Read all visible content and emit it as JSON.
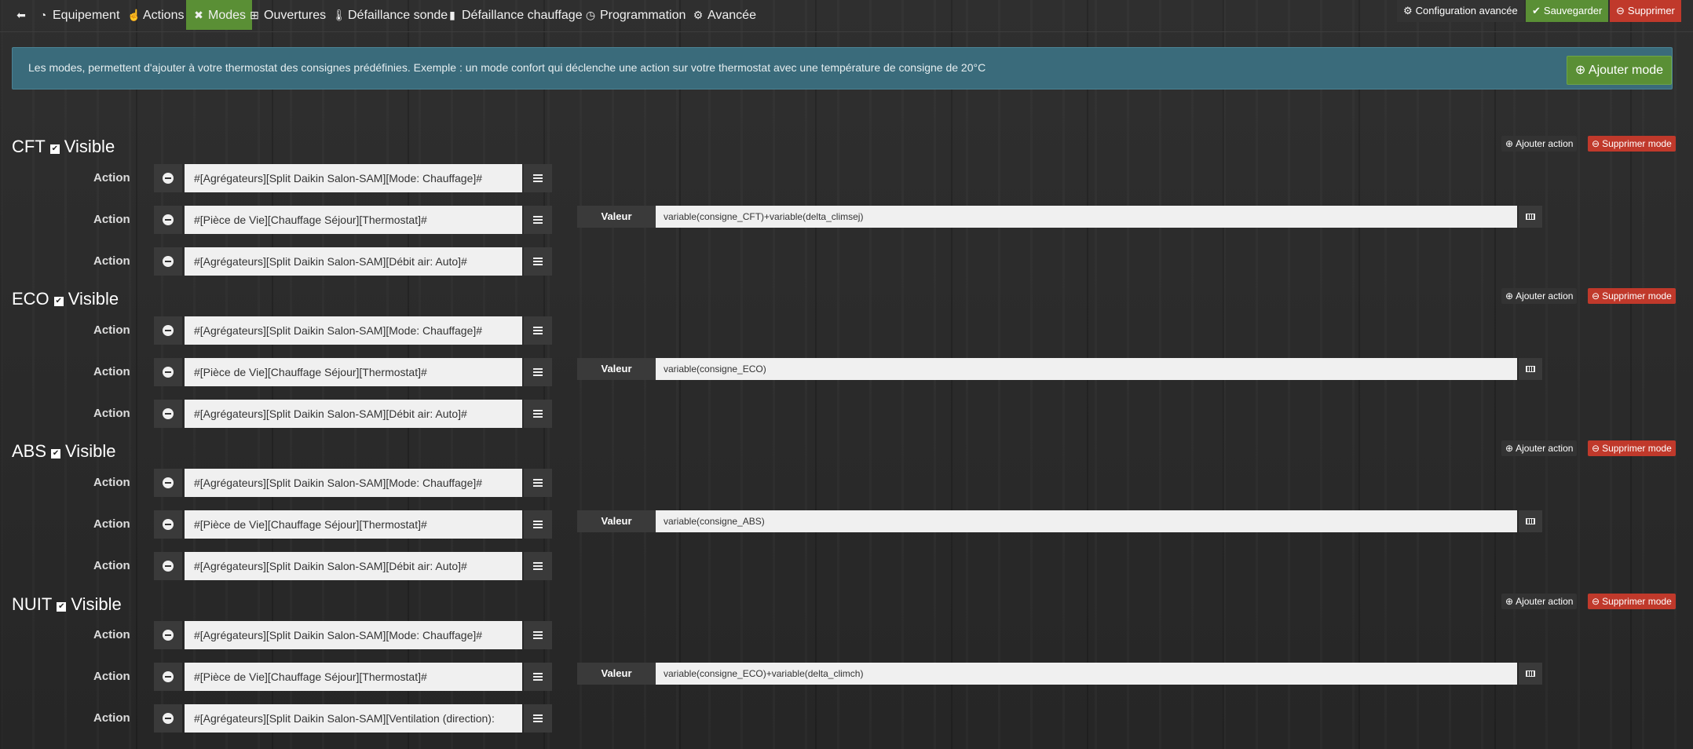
{
  "nav": {
    "back_icon": "arrow-left-icon",
    "tabs": [
      {
        "label": "Equipement",
        "icon": "dashboard-icon"
      },
      {
        "label": "Actions",
        "icon": "hand-icon"
      },
      {
        "label": "Modes",
        "icon": "modes-icon",
        "active": true
      },
      {
        "label": "Ouvertures",
        "icon": "window-icon"
      },
      {
        "label": "Défaillance sonde",
        "icon": "thermometer-icon"
      },
      {
        "label": "Défaillance chauffage",
        "icon": "heater-icon"
      },
      {
        "label": "Programmation",
        "icon": "clock-icon"
      },
      {
        "label": "Avancée",
        "icon": "gear-icon"
      }
    ],
    "config_label": "Configuration avancée",
    "save_label": "Sauvegarder",
    "delete_label": "Supprimer"
  },
  "info": {
    "text": "Les modes, permettent d'ajouter à votre thermostat des consignes prédéfinies. Exemple : un mode confort qui déclenche une action sur votre thermostat avec une température de consigne de 20°C",
    "add_mode_label": "Ajouter mode"
  },
  "labels": {
    "visible": "Visible",
    "add_action": "Ajouter action",
    "delete_mode": "Supprimer mode",
    "action": "Action",
    "valeur": "Valeur"
  },
  "modes": [
    {
      "name": "CFT",
      "actions": [
        "#[Agrégateurs][Split Daikin Salon-SAM][Mode: Chauffage]#",
        "#[Pièce de Vie][Chauffage Séjour][Thermostat]#",
        "#[Agrégateurs][Split Daikin Salon-SAM][Débit air: Auto]#"
      ],
      "valeur": "variable(consigne_CFT)+variable(delta_climsej)"
    },
    {
      "name": "ECO",
      "actions": [
        "#[Agrégateurs][Split Daikin Salon-SAM][Mode: Chauffage]#",
        "#[Pièce de Vie][Chauffage Séjour][Thermostat]#",
        "#[Agrégateurs][Split Daikin Salon-SAM][Débit air: Auto]#"
      ],
      "valeur": "variable(consigne_ECO)"
    },
    {
      "name": "ABS",
      "actions": [
        "#[Agrégateurs][Split Daikin Salon-SAM][Mode: Chauffage]#",
        "#[Pièce de Vie][Chauffage Séjour][Thermostat]#",
        "#[Agrégateurs][Split Daikin Salon-SAM][Débit air: Auto]#"
      ],
      "valeur": "variable(consigne_ABS)"
    },
    {
      "name": "NUIT",
      "actions": [
        "#[Agrégateurs][Split Daikin Salon-SAM][Mode: Chauffage]#",
        "#[Pièce de Vie][Chauffage Séjour][Thermostat]#",
        "#[Agrégateurs][Split Daikin Salon-SAM][Ventilation (direction):"
      ],
      "valeur": "variable(consigne_ECO)+variable(delta_climch)"
    }
  ]
}
